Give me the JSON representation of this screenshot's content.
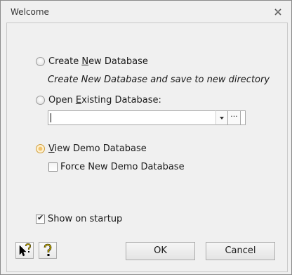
{
  "window": {
    "title": "Welcome",
    "close_icon": "close-icon"
  },
  "options": {
    "create_new": {
      "label_prefix": "Create ",
      "label_mnemonic": "N",
      "label_suffix": "ew Database",
      "description": "Create New Database and save to new directory",
      "selected": false
    },
    "open_existing": {
      "label_prefix": "Open ",
      "label_mnemonic": "E",
      "label_suffix": "xisting Database:",
      "path_value": "",
      "browse_label": "···",
      "selected": false
    },
    "view_demo": {
      "label_prefix": "",
      "label_mnemonic": "V",
      "label_suffix": "iew Demo Database",
      "selected": true,
      "force_new_demo": {
        "label": "Force New Demo Database",
        "checked": false
      }
    }
  },
  "show_on_startup": {
    "label": "Show on startup",
    "checked": true
  },
  "footer": {
    "context_help_icon": "pointer-question-icon",
    "help_icon": "question-mark-icon",
    "ok_label": "OK",
    "cancel_label": "Cancel"
  },
  "colors": {
    "window_bg": "#f0f0f0",
    "selected_radio": "#f3c36a"
  }
}
